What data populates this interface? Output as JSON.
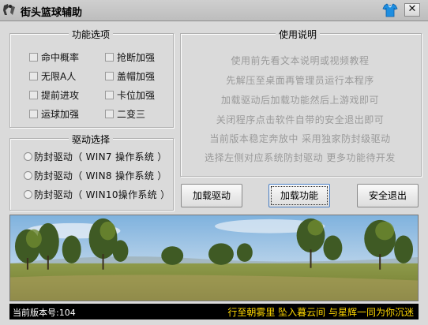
{
  "window": {
    "title": "街头篮球辅助",
    "close_glyph": "✕"
  },
  "features": {
    "title": "功能选项",
    "left": [
      "命中概率",
      "无限A人",
      "提前进攻",
      "运球加强"
    ],
    "right": [
      "抢断加强",
      "盖帽加强",
      "卡位加强",
      "二变三"
    ]
  },
  "driver": {
    "title": "驱动选择",
    "options": [
      "防封驱动（ WIN7 操作系统 ）",
      "防封驱动（ WIN8 操作系统 ）",
      "防封驱动（ WIN10操作系统 ）"
    ]
  },
  "instructions": {
    "title": "使用说明",
    "lines": [
      "使用前先看文本说明或视频教程",
      "先解压至桌面再管理员运行本程序",
      "加载驱动后加载功能然后上游戏即可",
      "关闭程序点击软件自带的安全退出即可",
      "当前版本稳定奔放中 采用独家防封级驱动",
      "选择左侧对应系统防封驱动 更多功能待开发"
    ]
  },
  "buttons": {
    "load_driver": "加载驱动",
    "load_features": "加载功能",
    "safe_exit": "安全退出"
  },
  "status": {
    "version": "当前版本号:104",
    "poem": "行至朝雾里 坠入暮云间 与星辉一同为你沉迷"
  },
  "colors": {
    "poem_text": "#ffd700",
    "status_bg": "#000000",
    "instruction_text": "#9a9a9a"
  }
}
